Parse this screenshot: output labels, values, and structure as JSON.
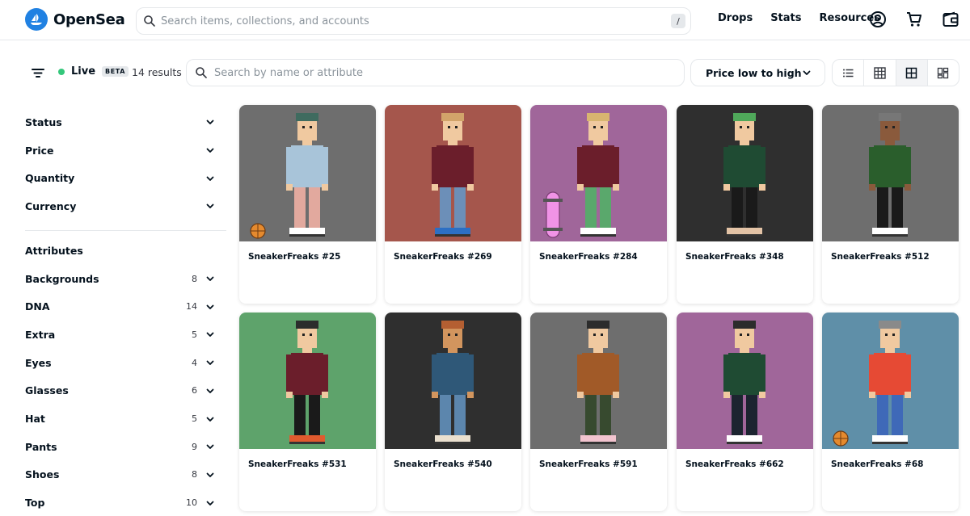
{
  "app": {
    "brand": "OpenSea"
  },
  "header": {
    "search_placeholder": "Search items, collections, and accounts",
    "slash_key": "/",
    "nav": [
      "Drops",
      "Stats",
      "Resources"
    ]
  },
  "toolbar": {
    "live_label": "Live",
    "beta_label": "BETA",
    "results_label": "14 results",
    "search_placeholder": "Search by name or attribute",
    "sort_label": "Price low to high"
  },
  "sidebar": {
    "filters": [
      {
        "label": "Status"
      },
      {
        "label": "Price"
      },
      {
        "label": "Quantity"
      },
      {
        "label": "Currency"
      }
    ],
    "attributes_title": "Attributes",
    "attributes": [
      {
        "label": "Backgrounds",
        "count": "8"
      },
      {
        "label": "DNA",
        "count": "14"
      },
      {
        "label": "Extra",
        "count": "5"
      },
      {
        "label": "Eyes",
        "count": "4"
      },
      {
        "label": "Glasses",
        "count": "6"
      },
      {
        "label": "Hat",
        "count": "5"
      },
      {
        "label": "Pants",
        "count": "9"
      },
      {
        "label": "Shoes",
        "count": "8"
      },
      {
        "label": "Top",
        "count": "10"
      }
    ]
  },
  "items": [
    {
      "name": "SneakerFreaks #25",
      "bg": "#6e6e6e",
      "skin": "#f0c9a0",
      "hair": "#3f6b5f",
      "top": "#a8c4d9",
      "pants": "#e2a99e",
      "shoe": "#ffffff",
      "extra": "basketball"
    },
    {
      "name": "SneakerFreaks #269",
      "bg": "#a5564c",
      "skin": "#f0c9a0",
      "hair": "#d2a46a",
      "top": "#6b1e2b",
      "pants": "#6c8fb8",
      "shoe": "#2c6fc4",
      "extra": ""
    },
    {
      "name": "SneakerFreaks #284",
      "bg": "#a0669a",
      "skin": "#f0c9a0",
      "hair": "#d8b570",
      "top": "#6b1e2b",
      "pants": "#5aa86c",
      "shoe": "#ffffff",
      "extra": "skateboard"
    },
    {
      "name": "SneakerFreaks #348",
      "bg": "#2f2f2f",
      "skin": "#f0c9a0",
      "hair": "#4fa85a",
      "top": "#1f4b33",
      "pants": "#1a1a1a",
      "shoe": "#e3c3a6",
      "extra": ""
    },
    {
      "name": "SneakerFreaks #512",
      "bg": "#6e6e6e",
      "skin": "#8a5a3c",
      "hair": "#777777",
      "top": "#2a5e2c",
      "pants": "#1a1a1a",
      "shoe": "#ffffff",
      "extra": ""
    },
    {
      "name": "SneakerFreaks #531",
      "bg": "#5ea36b",
      "skin": "#f0c9a0",
      "hair": "#2c2c2c",
      "top": "#6b1e2b",
      "pants": "#1a1a1a",
      "shoe": "#e05a2e",
      "extra": ""
    },
    {
      "name": "SneakerFreaks #540",
      "bg": "#2f2f2f",
      "skin": "#d2955e",
      "hair": "#b45f32",
      "top": "#2f5878",
      "pants": "#5c86ad",
      "shoe": "#eae0cf",
      "extra": ""
    },
    {
      "name": "SneakerFreaks #591",
      "bg": "#6e6e6e",
      "skin": "#f0c9a0",
      "hair": "#2c2c2c",
      "top": "#a15a28",
      "pants": "#374a2f",
      "shoe": "#f2c4cf",
      "extra": ""
    },
    {
      "name": "SneakerFreaks #662",
      "bg": "#a0669a",
      "skin": "#f0c9a0",
      "hair": "#2c2c2c",
      "top": "#1f4b33",
      "pants": "#1c2430",
      "shoe": "#ffffff",
      "extra": ""
    },
    {
      "name": "SneakerFreaks #68",
      "bg": "#5f8fa8",
      "skin": "#f0c9a0",
      "hair": "#8a8a8a",
      "top": "#e64a34",
      "pants": "#3f69b8",
      "shoe": "#ffffff",
      "extra": "basketball"
    }
  ],
  "colors": {
    "accent": "#2081e2",
    "live": "#34c77b",
    "border": "#e5e8eb"
  }
}
